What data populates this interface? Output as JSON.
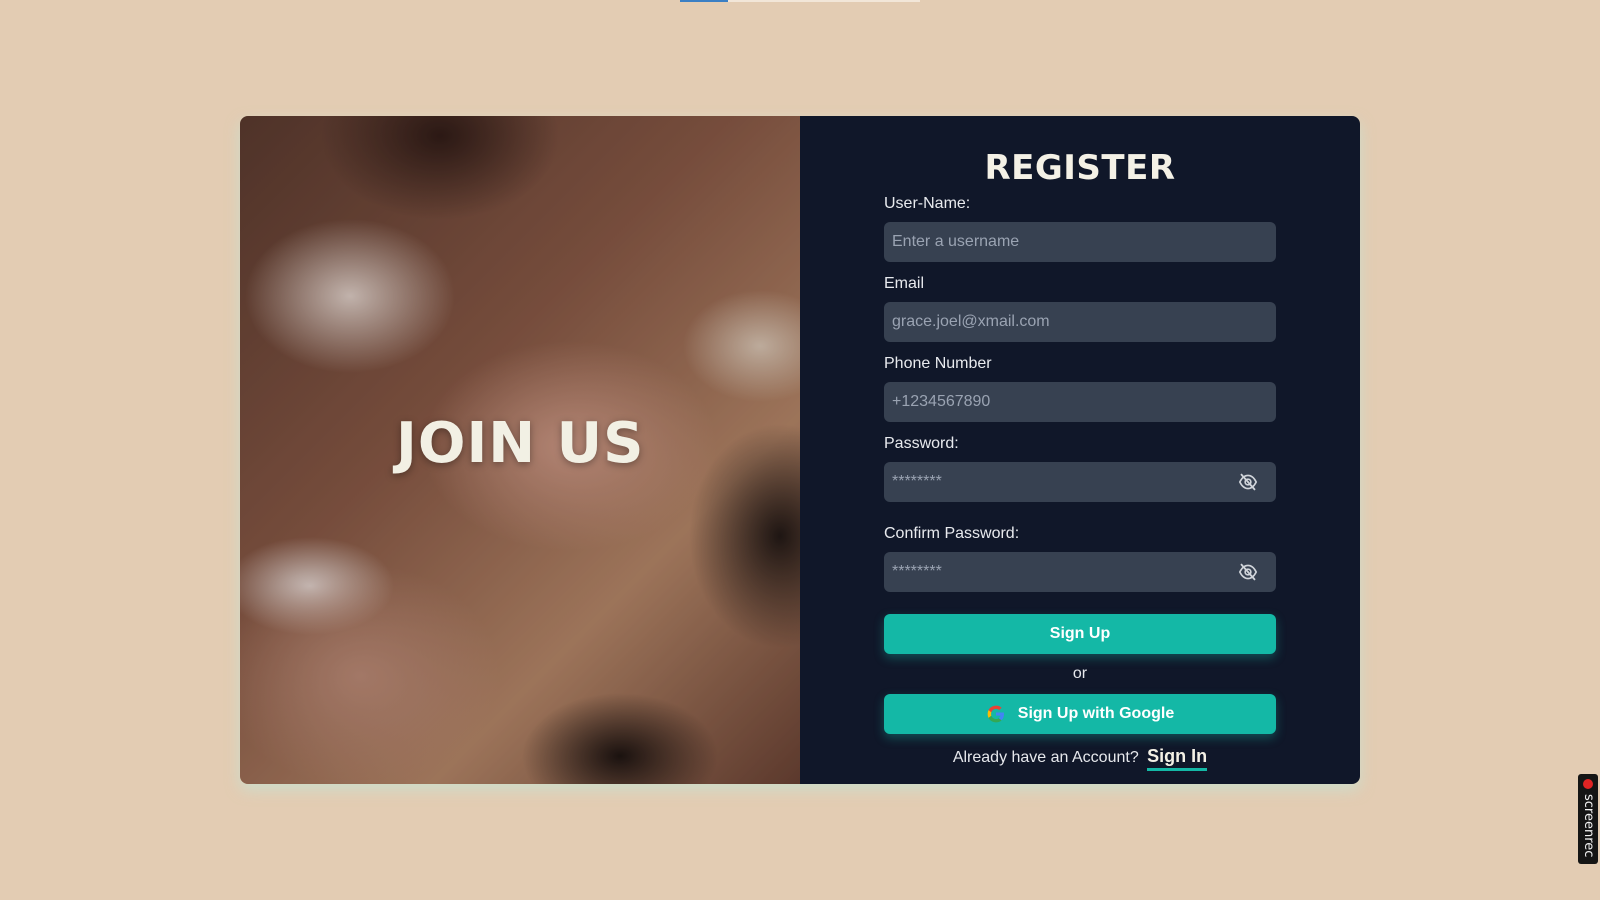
{
  "top_progress": {
    "value": 0.2
  },
  "left_panel": {
    "heading": "JOIN US"
  },
  "form": {
    "title": "REGISTER",
    "username": {
      "label": "User-Name:",
      "placeholder": "Enter a username",
      "value": ""
    },
    "email": {
      "label": "Email",
      "placeholder": "grace.joel@xmail.com",
      "value": ""
    },
    "phone": {
      "label": "Phone Number",
      "placeholder": "+1234567890",
      "value": ""
    },
    "password": {
      "label": "Password:",
      "placeholder": "********",
      "value": "",
      "toggle_icon": "eye-slash-icon"
    },
    "confirm_password": {
      "label": "Confirm Password:",
      "placeholder": "********",
      "value": "",
      "toggle_icon": "eye-slash-icon"
    },
    "signup_label": "Sign Up",
    "or_text": "or",
    "google_label": "Sign Up with Google",
    "google_icon": "google-icon",
    "signin_prompt": "Already have an Account?",
    "signin_label": "Sign In"
  },
  "overlay": {
    "screenrec_label": "screenrec"
  },
  "colors": {
    "page_background": "#e3ccb3",
    "form_background": "#101729",
    "input_background": "#374151",
    "accent": "#14b8a6"
  }
}
